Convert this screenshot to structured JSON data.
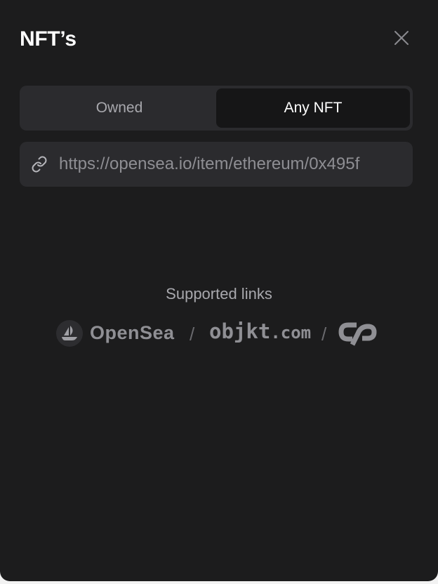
{
  "header": {
    "title": "NFT’s",
    "close_icon": "close-icon"
  },
  "tabs": [
    {
      "label": "Owned",
      "active": false
    },
    {
      "label": "Any NFT",
      "active": true
    }
  ],
  "url_input": {
    "icon": "link-icon",
    "value": "https://opensea.io/item/ethereum/0x495f"
  },
  "supported": {
    "label": "Supported links",
    "separator": "/",
    "logos": [
      {
        "name": "OpenSea",
        "icon": "opensea-icon"
      },
      {
        "name": "objkt",
        "suffix": ".com"
      },
      {
        "name": "Counterparty",
        "icon": "cp-logo-icon"
      }
    ]
  },
  "colors": {
    "background": "#1c1c1d",
    "surface": "#2b2b2e",
    "active_tab": "#161617",
    "text_primary": "#ffffff",
    "text_muted": "#a8a8ad"
  }
}
